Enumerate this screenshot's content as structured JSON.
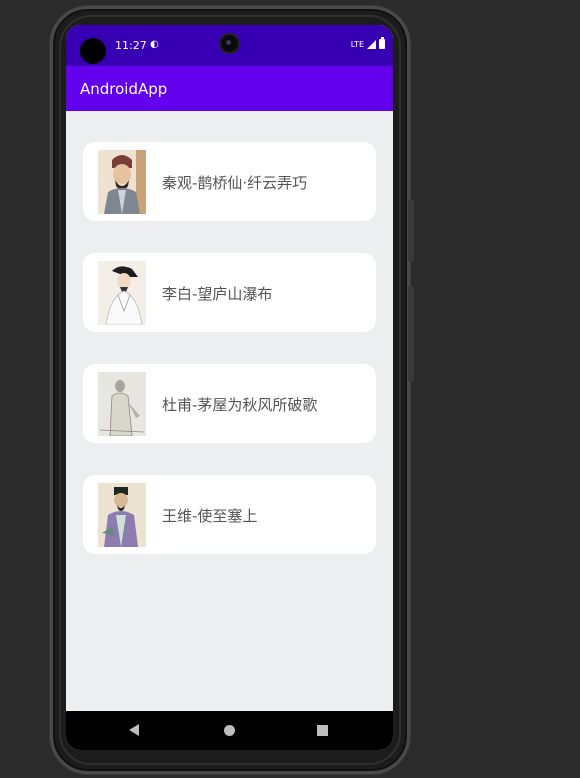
{
  "status_bar": {
    "time": "11:27",
    "network": "LTE",
    "app_icon": "play-store-icon"
  },
  "app_bar": {
    "title": "AndroidApp"
  },
  "poems": [
    {
      "label": "秦观-鹊桥仙·纤云弄巧",
      "portrait": "qin-guan-portrait-icon"
    },
    {
      "label": "李白-望庐山瀑布",
      "portrait": "li-bai-portrait-icon"
    },
    {
      "label": "杜甫-茅屋为秋风所破歌",
      "portrait": "du-fu-portrait-icon"
    },
    {
      "label": "王维-使至塞上",
      "portrait": "wang-wei-portrait-icon"
    }
  ],
  "nav_bar": {
    "back": "back-icon",
    "home": "home-icon",
    "recents": "recents-icon"
  },
  "colors": {
    "status_bar": "#3700b3",
    "app_bar": "#6200ee",
    "background": "#eceeef",
    "card": "#ffffff",
    "card_text": "#555555"
  }
}
